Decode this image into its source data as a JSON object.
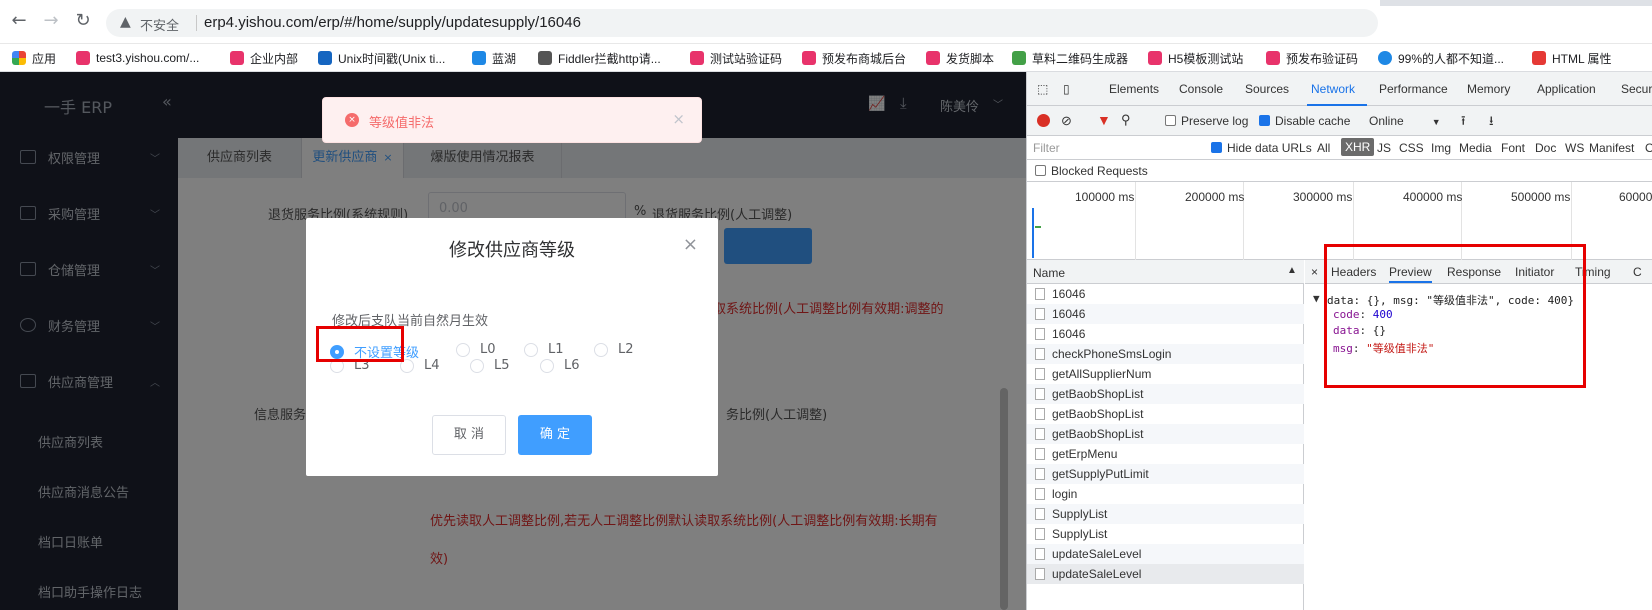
{
  "browser": {
    "back_icon": "back-arrow-icon",
    "insecure_label": "不安全",
    "url": "erp4.yishou.com/erp/#/home/supply/updatesupply/16046"
  },
  "bookmarks": [
    {
      "label": "应用",
      "color": "#e8453c"
    },
    {
      "label": "test3.yishou.com/...",
      "color": "#e8336b"
    },
    {
      "label": "企业内部",
      "color": "#e8336b"
    },
    {
      "label": "Unix时间戳(Unix ti...",
      "color": "#1565c0"
    },
    {
      "label": "蓝湖",
      "color": "#1e88e5"
    },
    {
      "label": "Fiddler拦截http请...",
      "color": "#555555"
    },
    {
      "label": "测试站验证码",
      "color": "#e8336b"
    },
    {
      "label": "预发布商城后台",
      "color": "#e8336b"
    },
    {
      "label": "发货脚本",
      "color": "#e8336b"
    },
    {
      "label": "草料二维码生成器",
      "color": "#43a047"
    },
    {
      "label": "H5模板测试站",
      "color": "#e8336b"
    },
    {
      "label": "预发布验证码",
      "color": "#e8336b"
    },
    {
      "label": "99%的人都不知道...",
      "color": "#1e88e5"
    },
    {
      "label": "HTML 属性",
      "color": "#e53935"
    }
  ],
  "sidebar": {
    "logo": "一手 ERP",
    "collapse": "«",
    "items": [
      {
        "label": "权限管理"
      },
      {
        "label": "采购管理"
      },
      {
        "label": "仓储管理"
      },
      {
        "label": "财务管理"
      },
      {
        "label": "供应商管理"
      }
    ],
    "subitems": [
      "供应商列表",
      "供应商消息公告",
      "档口日账单",
      "档口助手操作日志"
    ]
  },
  "header": {
    "user": "陈美伶"
  },
  "tabs": [
    {
      "label": "供应商列表"
    },
    {
      "label": "更新供应商"
    },
    {
      "label": "爆版使用情况报表"
    }
  ],
  "form": {
    "return_ratio_label": "退货服务比例(系统规则)",
    "return_ratio_value": "0.00",
    "percent": "%",
    "return_ratio_manual": "退货服务比例(人工调整)",
    "red_note_1": "读取系统比例(人工调整比例有效期:调整的",
    "info_label": "信息服务",
    "info_manual": "务比例(人工调整)",
    "red_note_2": "优先读取人工调整比例,若无人工调整比例默认读取系统比例(人工调整比例有效期:长期有",
    "red_note_2b": "效)"
  },
  "toast": {
    "message": "等级值非法"
  },
  "dialog": {
    "title": "修改供应商等级",
    "note": "修改后支队当前自然月生效",
    "options": [
      "不设置等级",
      "L0",
      "L1",
      "L2",
      "L3",
      "L4",
      "L5",
      "L6"
    ],
    "selected": "不设置等级",
    "cancel": "取 消",
    "confirm": "确 定"
  },
  "devtools": {
    "tabs": [
      "Elements",
      "Console",
      "Sources",
      "Network",
      "Performance",
      "Memory",
      "Application",
      "Securi"
    ],
    "active_tab": "Network",
    "preserve_log": "Preserve log",
    "disable_cache": "Disable cache",
    "throttle": "Online",
    "filter_placeholder": "Filter",
    "hide_data_urls": "Hide data URLs",
    "filter_types": [
      "All",
      "XHR",
      "JS",
      "CSS",
      "Img",
      "Media",
      "Font",
      "Doc",
      "WS",
      "Manifest",
      "O"
    ],
    "blocked_requests": "Blocked Requests",
    "timeline_ticks": [
      "100000 ms",
      "200000 ms",
      "300000 ms",
      "400000 ms",
      "500000 ms",
      "60000"
    ],
    "name_header": "Name",
    "requests": [
      "16046",
      "16046",
      "16046",
      "checkPhoneSmsLogin",
      "getAllSupplierNum",
      "getBaobShopList",
      "getBaobShopList",
      "getBaobShopList",
      "getErpMenu",
      "getSupplyPutLimit",
      "login",
      "SupplyList",
      "SupplyList",
      "updateSaleLevel",
      "updateSaleLevel"
    ],
    "detail_tabs": [
      "Headers",
      "Preview",
      "Response",
      "Initiator",
      "Timing",
      "C"
    ],
    "active_detail_tab": "Preview",
    "preview": {
      "summary": "data: {}, msg: \"等级值非法\", code: 400}",
      "code_key": "code",
      "code_val": "400",
      "data_key": "data",
      "data_val": "{}",
      "msg_key": "msg",
      "msg_val": "\"等级值非法\""
    }
  }
}
